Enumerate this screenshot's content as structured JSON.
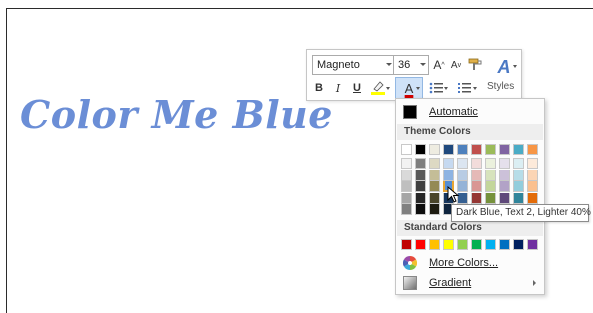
{
  "document": {
    "text": "Color Me Blue",
    "text_color": "#6b8ed6"
  },
  "toolbar": {
    "font_name": "Magneto",
    "font_size": "36",
    "grow_font_label": "A",
    "shrink_font_label": "A",
    "bold_label": "B",
    "italic_label": "I",
    "underline_label": "U",
    "font_color_label": "A",
    "styles_label": "Styles",
    "styles_icon_label": "A",
    "icons": [
      "grow-font-icon",
      "shrink-font-icon",
      "format-painter-icon",
      "highlight-icon",
      "bullets-icon",
      "numbering-icon",
      "styles-icon"
    ]
  },
  "color_menu": {
    "automatic_label": "Automatic",
    "theme_colors_label": "Theme Colors",
    "standard_colors_label": "Standard Colors",
    "more_colors_label": "More Colors...",
    "gradient_label": "Gradient",
    "theme_colors": [
      [
        "#ffffff",
        "#f2f2f2",
        "#d9d9d9",
        "#bfbfbf",
        "#a6a6a6",
        "#808080"
      ],
      [
        "#000000",
        "#7f7f7f",
        "#595959",
        "#3f3f3f",
        "#262626",
        "#0d0d0d"
      ],
      [
        "#eeece1",
        "#ddd9c3",
        "#c4bd97",
        "#948a54",
        "#4a452a",
        "#1e1c11"
      ],
      [
        "#1f497d",
        "#c6d9f0",
        "#8db3e2",
        "#548dd4",
        "#17365d",
        "#0f243e"
      ],
      [
        "#4f81bd",
        "#dbe5f1",
        "#b8cce4",
        "#95b3d7",
        "#366092",
        "#244061"
      ],
      [
        "#c0504d",
        "#f2dcdb",
        "#e5b9b7",
        "#d99694",
        "#953734",
        "#632423"
      ],
      [
        "#9bbb59",
        "#ebf1dd",
        "#d7e3bc",
        "#c3d69b",
        "#76923c",
        "#4f6128"
      ],
      [
        "#8064a2",
        "#e5e0ec",
        "#ccc1d9",
        "#b2a2c7",
        "#5f497a",
        "#3f3151"
      ],
      [
        "#4bacc6",
        "#dbeef3",
        "#b7dde8",
        "#92cddc",
        "#31859b",
        "#205867"
      ],
      [
        "#f79646",
        "#fdeada",
        "#fbd5b5",
        "#fac08f",
        "#e36c09",
        "#974806"
      ]
    ],
    "standard_colors": [
      "#c00000",
      "#ff0000",
      "#ffc000",
      "#ffff00",
      "#92d050",
      "#00b050",
      "#00b0f0",
      "#0070c0",
      "#002060",
      "#7030a0"
    ],
    "hovered_swatch": {
      "column": 3,
      "row": 3
    }
  },
  "tooltip": {
    "text": "Dark Blue, Text 2, Lighter 40%"
  }
}
